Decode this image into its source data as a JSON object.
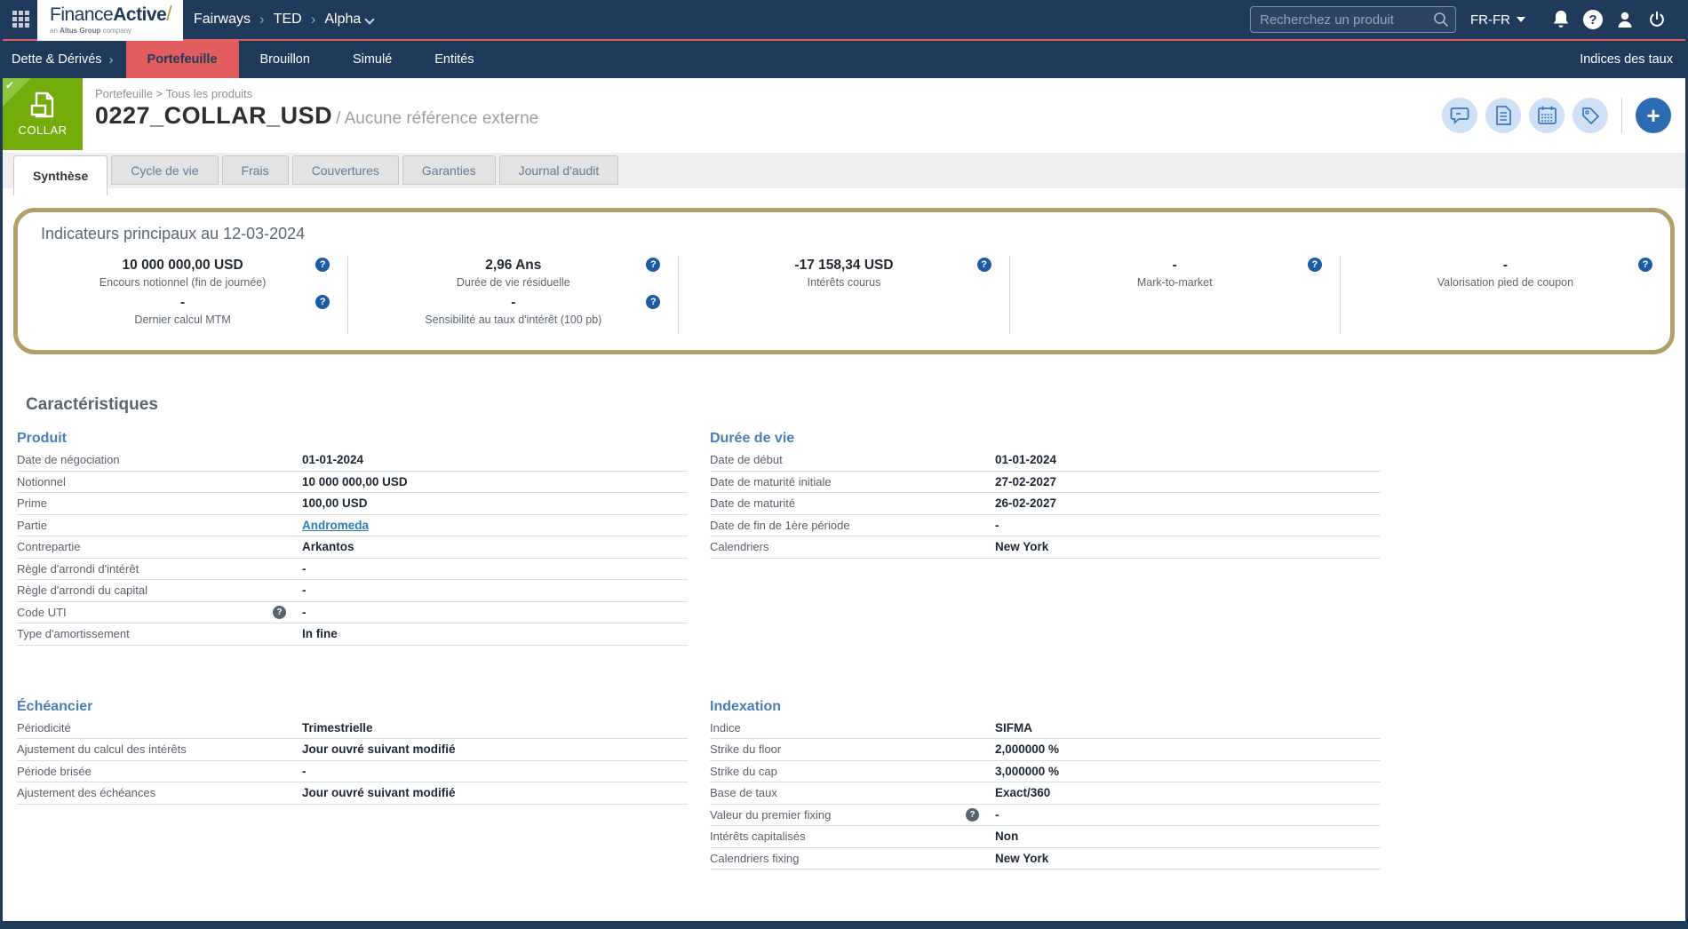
{
  "topbar": {
    "logo": {
      "name_light": "Finance",
      "name_bold": "Active",
      "slash": "/",
      "tagline_pre": "an ",
      "tagline_bold": "Altus Group",
      "tagline_post": " company"
    },
    "breadcrumb": [
      "Fairways",
      "TED",
      "Alpha"
    ],
    "separator": "›",
    "search_placeholder": "Recherchez un produit",
    "locale": "FR-FR"
  },
  "navbar": {
    "section": "Dette & Dérivés",
    "section_chevron": "›",
    "items": [
      "Portefeuille",
      "Brouillon",
      "Simulé",
      "Entités"
    ],
    "active_item": "Portefeuille",
    "right_link": "Indices des taux"
  },
  "header": {
    "badge_label": "COLLAR",
    "badge_check": "✔",
    "breadcrumb": "Portefeuille > Tous les produits",
    "title": "0227_COLLAR_USD",
    "subtitle": "/ Aucune référence externe",
    "plus_label": "+"
  },
  "tabs": {
    "active": "Synthèse",
    "items": [
      "Synthèse",
      "Cycle de vie",
      "Frais",
      "Couvertures",
      "Garanties",
      "Journal d'audit"
    ]
  },
  "indicators": {
    "title": "Indicateurs principaux au 12-03-2024",
    "help_glyph": "?",
    "columns": [
      {
        "items": [
          {
            "value": "10 000 000,00 USD",
            "label": "Encours notionnel (fin de journée)"
          },
          {
            "value": "-",
            "label": "Dernier calcul MTM"
          }
        ]
      },
      {
        "items": [
          {
            "value": "2,96 Ans",
            "label": "Durée de vie résiduelle"
          },
          {
            "value": "-",
            "label": "Sensibilité au taux d'intérêt (100 pb)"
          }
        ]
      },
      {
        "items": [
          {
            "value": "-17 158,34 USD",
            "label": "Intérêts courus"
          }
        ]
      },
      {
        "items": [
          {
            "value": "-",
            "label": "Mark-to-market"
          }
        ]
      },
      {
        "items": [
          {
            "value": "-",
            "label": "Valorisation pied de coupon"
          }
        ]
      }
    ]
  },
  "characteristics": {
    "title": "Caractéristiques",
    "sections": [
      {
        "title": "Produit",
        "rows": [
          {
            "label": "Date de négociation",
            "value": "01-01-2024"
          },
          {
            "label": "Notionnel",
            "value": "10 000 000,00 USD"
          },
          {
            "label": "Prime",
            "value": "100,00 USD"
          },
          {
            "label": "Partie",
            "value": "Andromeda",
            "link": true
          },
          {
            "label": "Contrepartie",
            "value": "Arkantos"
          },
          {
            "label": "Règle d'arrondi d'intérêt",
            "value": "-"
          },
          {
            "label": "Règle d'arrondi du capital",
            "value": "-"
          },
          {
            "label": "Code UTI",
            "value": "-",
            "help": true
          },
          {
            "label": "Type d'amortissement",
            "value": "In fine"
          }
        ]
      },
      {
        "title": "Durée de vie",
        "rows": [
          {
            "label": "Date de début",
            "value": "01-01-2024"
          },
          {
            "label": "Date de maturité initiale",
            "value": "27-02-2027"
          },
          {
            "label": "Date de maturité",
            "value": "26-02-2027"
          },
          {
            "label": "Date de fin de 1ère période",
            "value": "-"
          },
          {
            "label": "Calendriers",
            "value": "New York"
          }
        ]
      },
      {
        "title": "Échéancier",
        "rows": [
          {
            "label": "Périodicité",
            "value": "Trimestrielle"
          },
          {
            "label": "Ajustement du calcul des intérêts",
            "value": "Jour ouvré suivant modifié"
          },
          {
            "label": "Période brisée",
            "value": "-"
          },
          {
            "label": "Ajustement des échéances",
            "value": "Jour ouvré suivant modifié"
          }
        ]
      },
      {
        "title": "Indexation",
        "rows": [
          {
            "label": "Indice",
            "value": "SIFMA"
          },
          {
            "label": "Strike du floor",
            "value": "2,000000 %"
          },
          {
            "label": "Strike du cap",
            "value": "3,000000 %"
          },
          {
            "label": "Base de taux",
            "value": "Exact/360"
          },
          {
            "label": "Valeur du premier fixing",
            "value": "-",
            "help": true
          },
          {
            "label": "Intérêts capitalisés",
            "value": "Non"
          },
          {
            "label": "Calendriers fixing",
            "value": "New York"
          }
        ]
      }
    ]
  },
  "colors": {
    "navy": "#203a5c",
    "red_accent": "#e25d5d",
    "badge_green": "#74ad0b",
    "badge_green_light": "#8dc63f",
    "panel_gold": "#b1a169",
    "section_blue": "#4a7fb5",
    "help_blue": "#1d5ca3",
    "action_icon_blue": "#3a77bd",
    "action_circle_bg": "#cfe0f4",
    "plus_button_bg": "#2d6cb3"
  }
}
